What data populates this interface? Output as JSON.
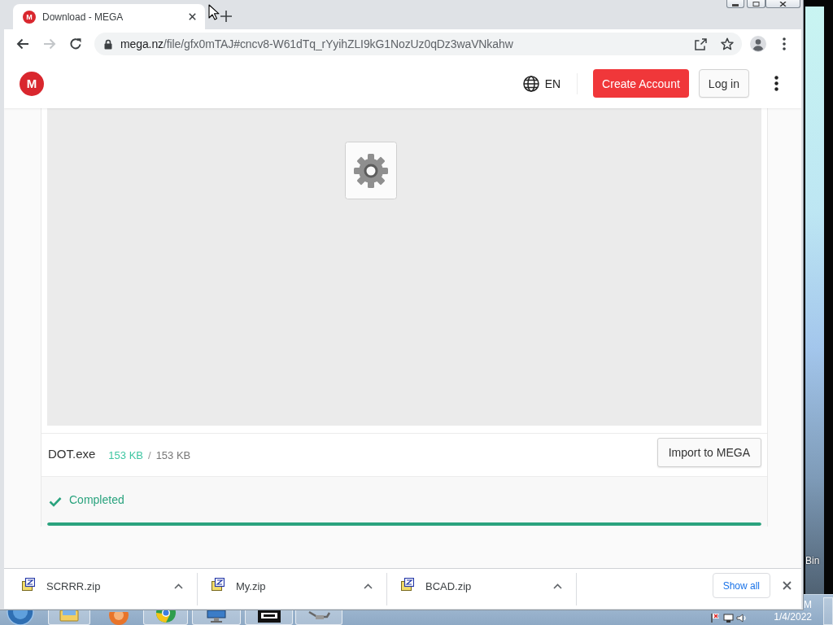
{
  "browser": {
    "tabs": [
      {
        "title": "Download - MEGA",
        "favicon_letter": "M",
        "selected": true
      }
    ],
    "toolbar": {
      "forward_disabled": true,
      "address": {
        "secure": true,
        "domain": "mega.nz",
        "path": "/file/gfx0mTAJ#cncv8-W61dTq_rYyihZLI9kG1NozUz0qDz3waVNkahw"
      },
      "bookmarked": false
    }
  },
  "page": {
    "header": {
      "logo_letter": "M",
      "language": "EN",
      "create_account": "Create Account",
      "log_in": "Log in"
    },
    "file": {
      "name": "DOT.exe",
      "downloaded": "153 KB",
      "separator": "/",
      "total": "153 KB",
      "import_button": "Import to MEGA"
    },
    "status": {
      "text": "Completed",
      "done": true,
      "level": 1
    }
  },
  "downloads_bar": {
    "items": [
      {
        "name": "SCRRR.zip"
      },
      {
        "name": "My.zip"
      },
      {
        "name": "BCAD.zip"
      }
    ],
    "show_all": "Show all"
  },
  "desktop": {
    "icon_label": "Bin"
  },
  "taskbar": {
    "clock_time": "M",
    "clock_date": "1/4/2022"
  }
}
